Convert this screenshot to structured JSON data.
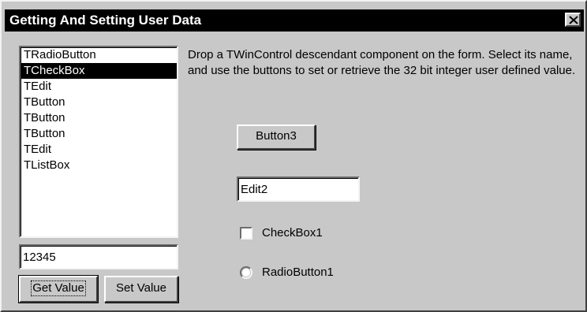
{
  "window": {
    "title": "Getting And Setting User Data",
    "close_glyph": "✕"
  },
  "listbox": {
    "items": [
      "TRadioButton",
      "TCheckBox",
      "TEdit",
      "TButton",
      "TButton",
      "TButton",
      "TEdit",
      "TListBox"
    ],
    "selected_index": 1
  },
  "value_field": {
    "value": "12345"
  },
  "buttons": {
    "get_value": "Get Value",
    "set_value": "Set Value",
    "button3": "Button3"
  },
  "description": "Drop a TWinControl descendant component on the form.  Select its name, and use the buttons to set or retrieve the 32 bit integer user defined value.",
  "edit2": {
    "value": "Edit2"
  },
  "checkbox1": {
    "label": "CheckBox1",
    "checked": false
  },
  "radiobutton1": {
    "label": "RadioButton1",
    "selected": false
  },
  "colors": {
    "title_bar": "#000000",
    "title_text": "#ffffff",
    "window_face": "#c8c8c8",
    "selection": "#000000"
  }
}
